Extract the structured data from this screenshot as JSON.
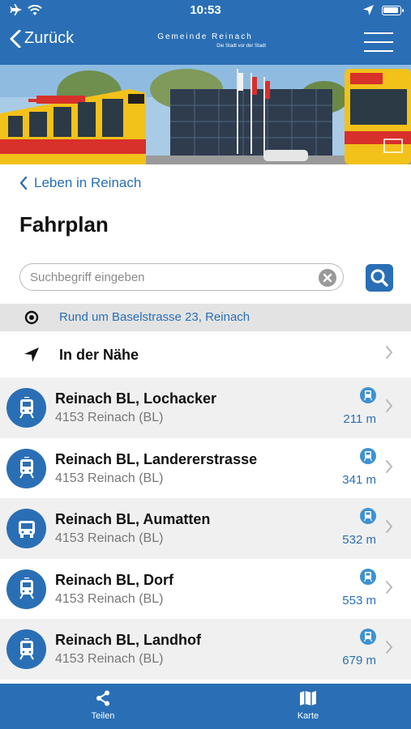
{
  "status_bar": {
    "time": "10:53"
  },
  "nav": {
    "back_label": "Zurück",
    "logo_line1": "Gemeinde Reinach",
    "logo_line2": "Die Stadt vor der Stadt"
  },
  "breadcrumb": {
    "label": "Leben in Reinach"
  },
  "page": {
    "title": "Fahrplan"
  },
  "search": {
    "placeholder": "Suchbegriff eingeben",
    "value": ""
  },
  "location": {
    "text": "Rund um Baselstrasse 23, Reinach"
  },
  "nearby": {
    "label": "In der Nähe"
  },
  "stops": [
    {
      "name": "Reinach BL, Lochacker",
      "address": "4153 Reinach (BL)",
      "distance": "211 m",
      "icon": "tram-icon"
    },
    {
      "name": "Reinach BL, Landererstrasse",
      "address": "4153 Reinach (BL)",
      "distance": "341 m",
      "icon": "tram-icon"
    },
    {
      "name": "Reinach BL, Aumatten",
      "address": "4153 Reinach (BL)",
      "distance": "532 m",
      "icon": "bus-icon"
    },
    {
      "name": "Reinach BL, Dorf",
      "address": "4153 Reinach (BL)",
      "distance": "553 m",
      "icon": "tram-icon"
    },
    {
      "name": "Reinach BL, Landhof",
      "address": "4153 Reinach (BL)",
      "distance": "679 m",
      "icon": "tram-icon"
    }
  ],
  "tabbar": {
    "share_label": "Teilen",
    "map_label": "Karte"
  },
  "colors": {
    "brand_blue": "#2a6fb5",
    "tram_yellow": "#f2c11a",
    "tram_red": "#d8302a"
  }
}
